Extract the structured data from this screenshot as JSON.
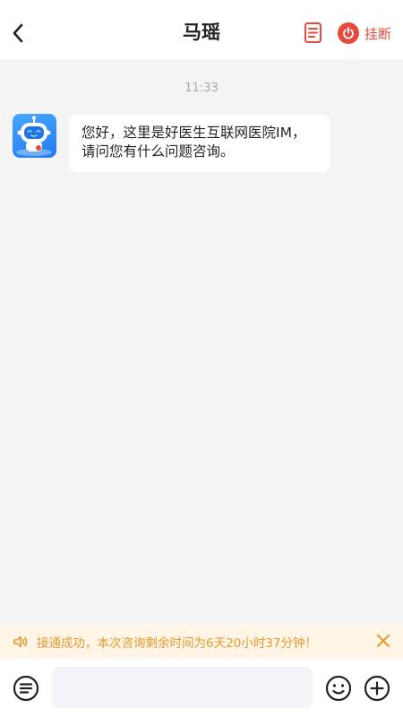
{
  "header": {
    "title": "马瑶",
    "hangup_label": "挂断",
    "back_icon": "chevron-left-icon",
    "record_icon": "document-icon",
    "hangup_icon": "power-icon",
    "hangup_color": "#e64a3c"
  },
  "chat": {
    "timestamp": "11:33",
    "messages": [
      {
        "sender": "bot",
        "avatar_icon": "robot-avatar-icon",
        "text": "您好，这里是好医生互联网医院IM，请问您有什么问题咨询。"
      }
    ]
  },
  "notice": {
    "icon": "speaker-icon",
    "text": "接通成功，本次咨询剩余时间为6天20小时37分钟！",
    "color": "#e39b2f",
    "background": "#fff5e6"
  },
  "input_bar": {
    "placeholder": "",
    "left_icon": "list-menu-icon",
    "emoji_icon": "emoji-icon",
    "plus_icon": "plus-icon"
  }
}
